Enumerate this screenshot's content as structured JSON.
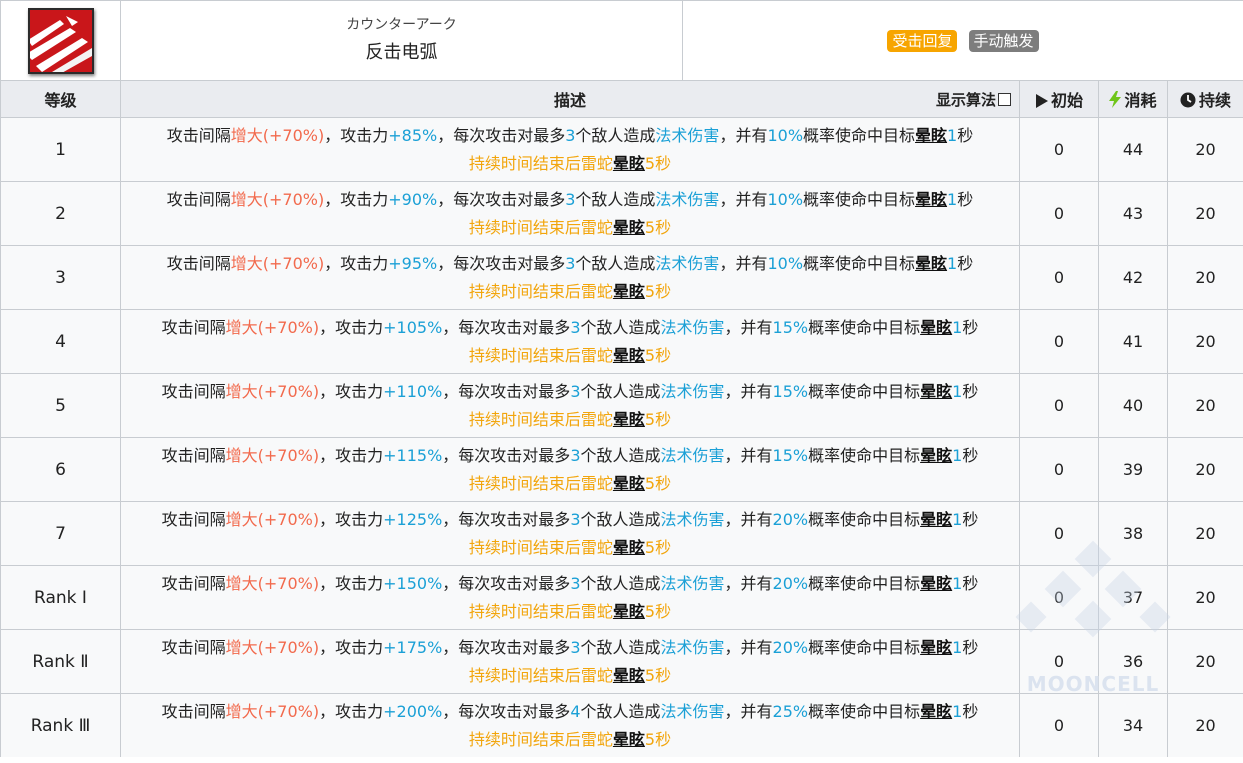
{
  "skill": {
    "name_jp": "カウンターアーク",
    "name_cn": "反击电弧",
    "tags": [
      "受击回复",
      "手动触发"
    ]
  },
  "columns": {
    "level": "等级",
    "description": "描述",
    "show_formula": "显示算法",
    "initial": "初始",
    "cost": "消耗",
    "duration": "持续"
  },
  "rows": [
    {
      "level": "1",
      "interval": "增大(+70%)",
      "atk": "+85%",
      "targets": "3",
      "chance": "10%",
      "stun": "1",
      "after_stun": "5",
      "initial": "0",
      "cost": "44",
      "duration": "20"
    },
    {
      "level": "2",
      "interval": "增大(+70%)",
      "atk": "+90%",
      "targets": "3",
      "chance": "10%",
      "stun": "1",
      "after_stun": "5",
      "initial": "0",
      "cost": "43",
      "duration": "20"
    },
    {
      "level": "3",
      "interval": "增大(+70%)",
      "atk": "+95%",
      "targets": "3",
      "chance": "10%",
      "stun": "1",
      "after_stun": "5",
      "initial": "0",
      "cost": "42",
      "duration": "20"
    },
    {
      "level": "4",
      "interval": "增大(+70%)",
      "atk": "+105%",
      "targets": "3",
      "chance": "15%",
      "stun": "1",
      "after_stun": "5",
      "initial": "0",
      "cost": "41",
      "duration": "20"
    },
    {
      "level": "5",
      "interval": "增大(+70%)",
      "atk": "+110%",
      "targets": "3",
      "chance": "15%",
      "stun": "1",
      "after_stun": "5",
      "initial": "0",
      "cost": "40",
      "duration": "20"
    },
    {
      "level": "6",
      "interval": "增大(+70%)",
      "atk": "+115%",
      "targets": "3",
      "chance": "15%",
      "stun": "1",
      "after_stun": "5",
      "initial": "0",
      "cost": "39",
      "duration": "20"
    },
    {
      "level": "7",
      "interval": "增大(+70%)",
      "atk": "+125%",
      "targets": "3",
      "chance": "20%",
      "stun": "1",
      "after_stun": "5",
      "initial": "0",
      "cost": "38",
      "duration": "20"
    },
    {
      "level": "Rank Ⅰ",
      "interval": "增大(+70%)",
      "atk": "+150%",
      "targets": "3",
      "chance": "20%",
      "stun": "1",
      "after_stun": "5",
      "initial": "0",
      "cost": "37",
      "duration": "20"
    },
    {
      "level": "Rank Ⅱ",
      "interval": "增大(+70%)",
      "atk": "+175%",
      "targets": "3",
      "chance": "20%",
      "stun": "1",
      "after_stun": "5",
      "initial": "0",
      "cost": "36",
      "duration": "20"
    },
    {
      "level": "Rank Ⅲ",
      "interval": "增大(+70%)",
      "atk": "+200%",
      "targets": "4",
      "chance": "25%",
      "stun": "1",
      "after_stun": "5",
      "initial": "0",
      "cost": "34",
      "duration": "20"
    }
  ],
  "text": {
    "p1": "攻击间隔",
    "p2": "，攻击力",
    "p3": "，每次攻击对最多",
    "p4": "个敌人造成",
    "damage_type": "法术伤害",
    "p5": "，并有",
    "p6": "概率使命中目标",
    "stun_word": "晕眩",
    "sec": "秒",
    "line2": "持续时间结束后雷蛇"
  },
  "watermark": "MOONCELL",
  "colors": {
    "red": "#f26a4d",
    "blue": "#1ba0d6",
    "orange": "#f2a50c",
    "tag_recovery": "#f7a500",
    "tag_trigger": "#7d7d7d"
  }
}
